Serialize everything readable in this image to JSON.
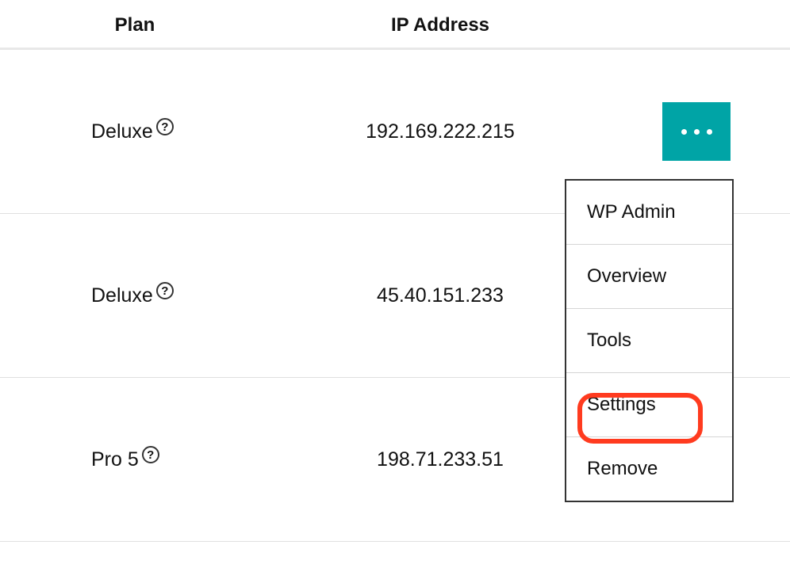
{
  "columns": {
    "plan": "Plan",
    "ip": "IP Address"
  },
  "rows": [
    {
      "plan": "Deluxe",
      "ip": "192.169.222.215"
    },
    {
      "plan": "Deluxe",
      "ip": "45.40.151.233"
    },
    {
      "plan": "Pro 5",
      "ip": "198.71.233.51"
    }
  ],
  "menu": {
    "wp_admin": "WP Admin",
    "overview": "Overview",
    "tools": "Tools",
    "settings": "Settings",
    "remove": "Remove"
  }
}
